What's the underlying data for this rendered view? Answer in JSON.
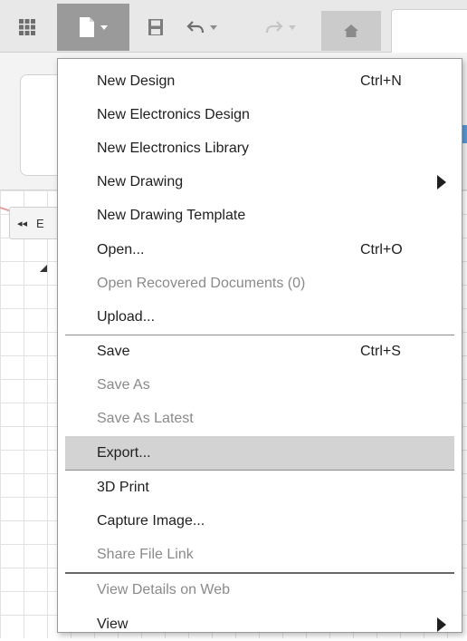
{
  "toolbar": {
    "icons": [
      "grid-icon",
      "file-icon",
      "save-icon",
      "undo-icon",
      "redo-icon",
      "home-icon"
    ],
    "file_button_color": "#9a9a9a"
  },
  "canvas": {
    "browser_letter": "E"
  },
  "menu": {
    "items": [
      {
        "label": "New Design",
        "shortcut": "Ctrl+N",
        "enabled": true
      },
      {
        "label": "New Electronics Design",
        "shortcut": "",
        "enabled": true
      },
      {
        "label": "New Electronics Library",
        "shortcut": "",
        "enabled": true
      },
      {
        "label": "New Drawing",
        "shortcut": "",
        "enabled": true,
        "submenu": true
      },
      {
        "label": "New Drawing Template",
        "shortcut": "",
        "enabled": true
      },
      {
        "label": "Open...",
        "shortcut": "Ctrl+O",
        "enabled": true
      },
      {
        "label": "Open Recovered Documents (0)",
        "shortcut": "",
        "enabled": false
      },
      {
        "label": "Upload...",
        "shortcut": "",
        "enabled": true
      },
      {
        "label": "Save",
        "shortcut": "Ctrl+S",
        "enabled": true
      },
      {
        "label": "Save As",
        "shortcut": "",
        "enabled": false
      },
      {
        "label": "Save As Latest",
        "shortcut": "",
        "enabled": false
      },
      {
        "label": "Export...",
        "shortcut": "",
        "enabled": true,
        "highlighted": true
      },
      {
        "label": "3D Print",
        "shortcut": "",
        "enabled": true
      },
      {
        "label": "Capture Image...",
        "shortcut": "",
        "enabled": true
      },
      {
        "label": "Share File Link",
        "shortcut": "",
        "enabled": false
      },
      {
        "label": "View Details on Web",
        "shortcut": "",
        "enabled": false
      },
      {
        "label": "View",
        "shortcut": "",
        "enabled": true,
        "submenu": true
      }
    ],
    "highlight_color": "#d3d3d3",
    "disabled_color": "#8a8a8a"
  }
}
